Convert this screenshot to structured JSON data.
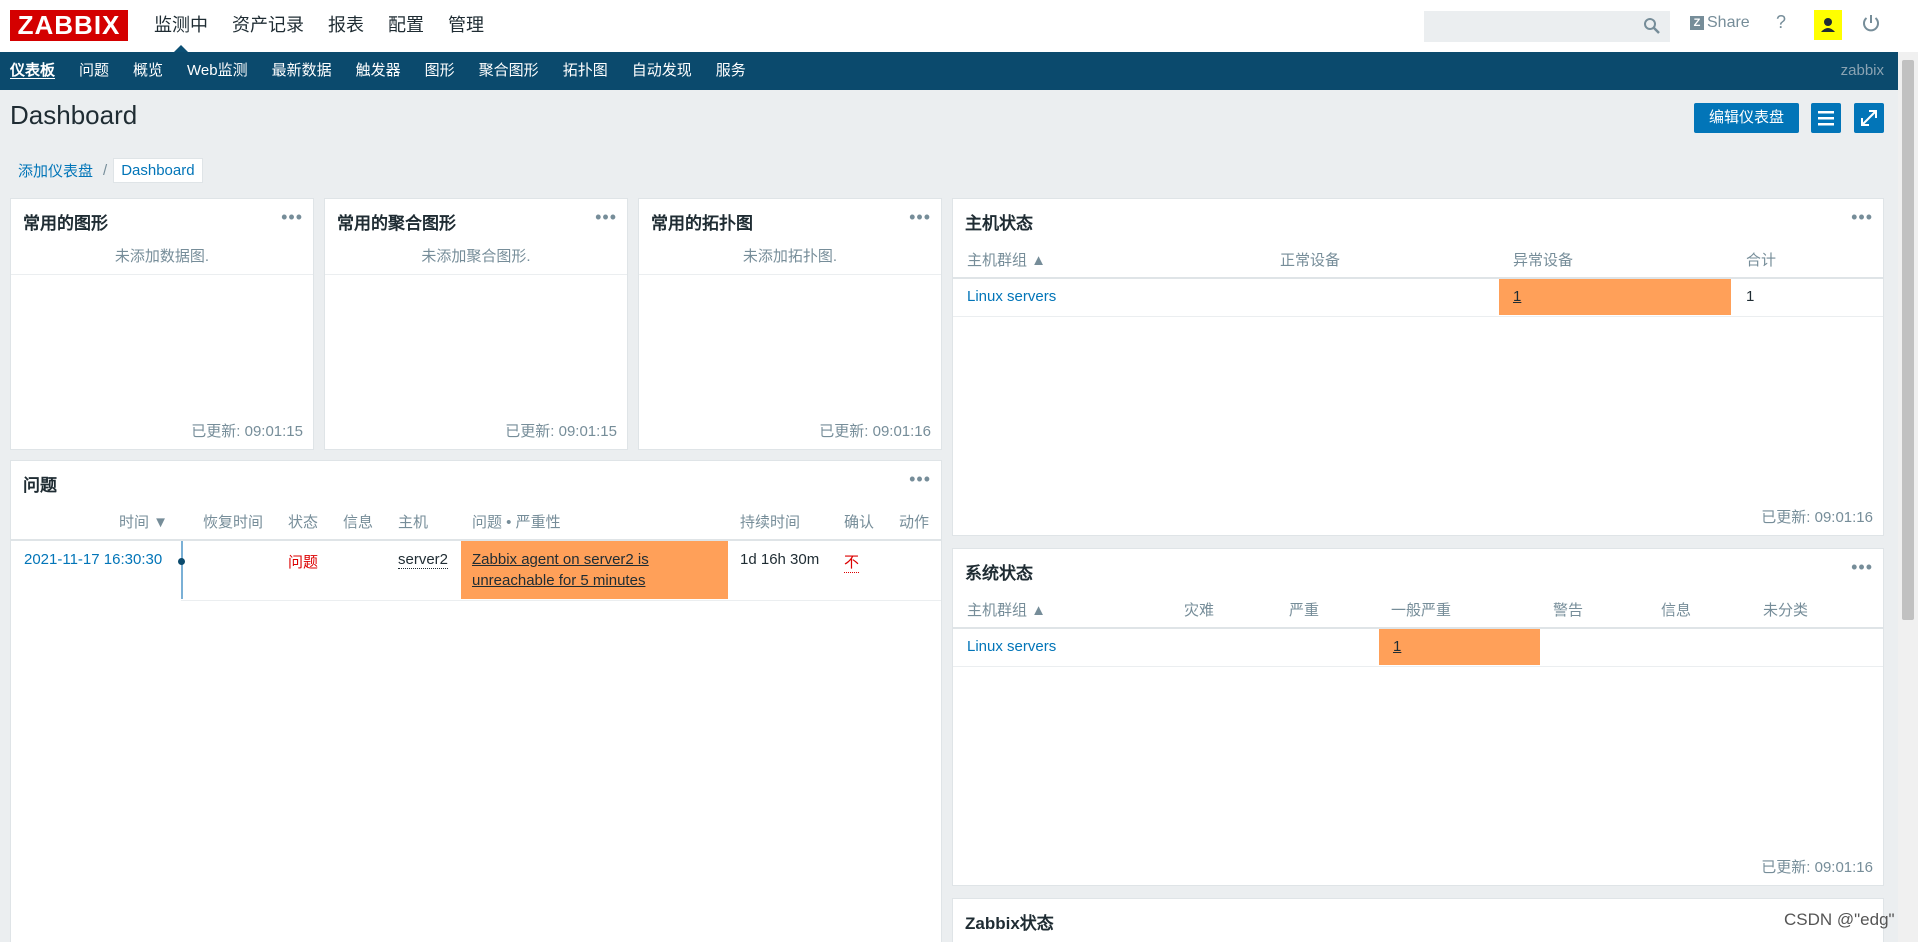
{
  "app": {
    "logo": "ZABBIX"
  },
  "main_menu": [
    "监测中",
    "资产记录",
    "报表",
    "配置",
    "管理"
  ],
  "share_label": "Share",
  "help_label": "?",
  "sub_menu": [
    "仪表板",
    "问题",
    "概览",
    "Web监测",
    "最新数据",
    "触发器",
    "图形",
    "聚合图形",
    "拓扑图",
    "自动发现",
    "服务"
  ],
  "server_name": "zabbix",
  "page_title": "Dashboard",
  "edit_button": "编辑仪表盘",
  "breadcrumb": {
    "parent": "添加仪表盘",
    "separator": "/",
    "current": "Dashboard"
  },
  "widgets": {
    "graphs": {
      "title": "常用的图形",
      "empty": "未添加数据图.",
      "updated": "已更新: 09:01:15"
    },
    "screens": {
      "title": "常用的聚合图形",
      "empty": "未添加聚合图形.",
      "updated": "已更新: 09:01:15"
    },
    "maps": {
      "title": "常用的拓扑图",
      "empty": "未添加拓扑图.",
      "updated": "已更新: 09:01:16"
    },
    "host_status": {
      "title": "主机状态",
      "headers": [
        "主机群组 ▲",
        "正常设备",
        "异常设备",
        "合计"
      ],
      "row": {
        "group": "Linux servers",
        "ok": "",
        "problem": "1",
        "total": "1"
      },
      "updated": "已更新: 09:01:16"
    },
    "problems": {
      "title": "问题",
      "headers": [
        "时间 ▼",
        "恢复时间",
        "状态",
        "信息",
        "主机",
        "问题 • 严重性",
        "持续时间",
        "确认",
        "动作"
      ],
      "row": {
        "time": "2021-11-17 16:30:30",
        "recovery": "",
        "status": "问题",
        "info": "",
        "host": "server2",
        "problem_line1": "Zabbix agent on server2 is",
        "problem_line2": "unreachable for 5 minutes",
        "duration": "1d 16h 30m",
        "ack": "不",
        "actions": ""
      }
    },
    "system_status": {
      "title": "系统状态",
      "headers": [
        "主机群组 ▲",
        "灾难",
        "严重",
        "一般严重",
        "警告",
        "信息",
        "未分类"
      ],
      "row": {
        "group": "Linux servers",
        "average": "1"
      },
      "updated": "已更新: 09:01:16"
    },
    "zabbix_status": {
      "title": "Zabbix状态"
    }
  },
  "watermark": "CSDN @\"edg\"",
  "colors": {
    "brand": "#d40000",
    "nav": "#0b4a6d",
    "accent": "#0275b8",
    "severity_average": "#ffa059",
    "user_highlight": "#ffff00"
  },
  "icons": [
    "search-icon",
    "share-icon",
    "help-icon",
    "user-icon",
    "power-icon",
    "list-icon",
    "fullscreen-icon",
    "more-icon"
  ]
}
